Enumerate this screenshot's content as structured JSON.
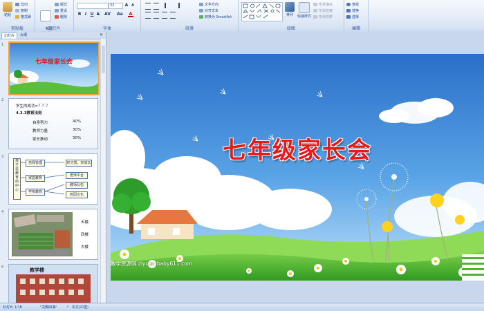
{
  "ribbon": {
    "clipboard": {
      "paste": "粘贴",
      "cut": "剪切",
      "copy": "复制",
      "format_painter": "格式刷",
      "label": "剪贴板"
    },
    "slides": {
      "new_slide": "新建\n幻灯片",
      "layout": "版式",
      "reset": "重设",
      "delete": "删除",
      "label": "幻灯片"
    },
    "font": {
      "size_value": "32",
      "label": "字体"
    },
    "paragraph": {
      "text_direction": "文字方向",
      "align_text": "对齐文本",
      "smartart": "转换为 SmartArt",
      "label": "段落"
    },
    "drawing": {
      "arrange": "排列",
      "quick_styles": "快速样式",
      "shape_fill": "形状填充",
      "shape_outline": "形状轮廓",
      "shape_effects": "形状效果",
      "label": "绘图"
    },
    "editing": {
      "find": "查找",
      "replace": "替换",
      "select": "选择",
      "label": "编辑"
    }
  },
  "pane_tabs": {
    "slides": "幻灯片",
    "outline": "大纲"
  },
  "thumbnails": [
    {
      "num": "1",
      "title": "七年级家长会"
    },
    {
      "num": "2",
      "lines": [
        "学生的成功=？？？",
        "4.3.3教育法则"
      ],
      "rows": [
        [
          "自身努力",
          "40%"
        ],
        [
          "教师力量",
          "30%"
        ],
        [
          "家长推动",
          "30%"
        ]
      ]
    },
    {
      "num": "3",
      "center": "孩子是教育的中心",
      "boxes": [
        "自我管理",
        "家庭教育",
        "学校教育"
      ],
      "right": [
        "好习惯，好成长",
        "老师平台",
        "教师队伍",
        "校园文化"
      ]
    },
    {
      "num": "4",
      "labels": [
        "五楼",
        "四楼",
        "大楼"
      ]
    },
    {
      "num": "5",
      "title": "教学楼"
    }
  ],
  "slide": {
    "title": "七年级家长会",
    "watermark": "教学资源网 ziyuan.baby611.com"
  },
  "statusbar": {
    "slide_info": "幻灯片 1/18",
    "theme": "\"龙腾四海\"",
    "language": "中文(中国)"
  }
}
